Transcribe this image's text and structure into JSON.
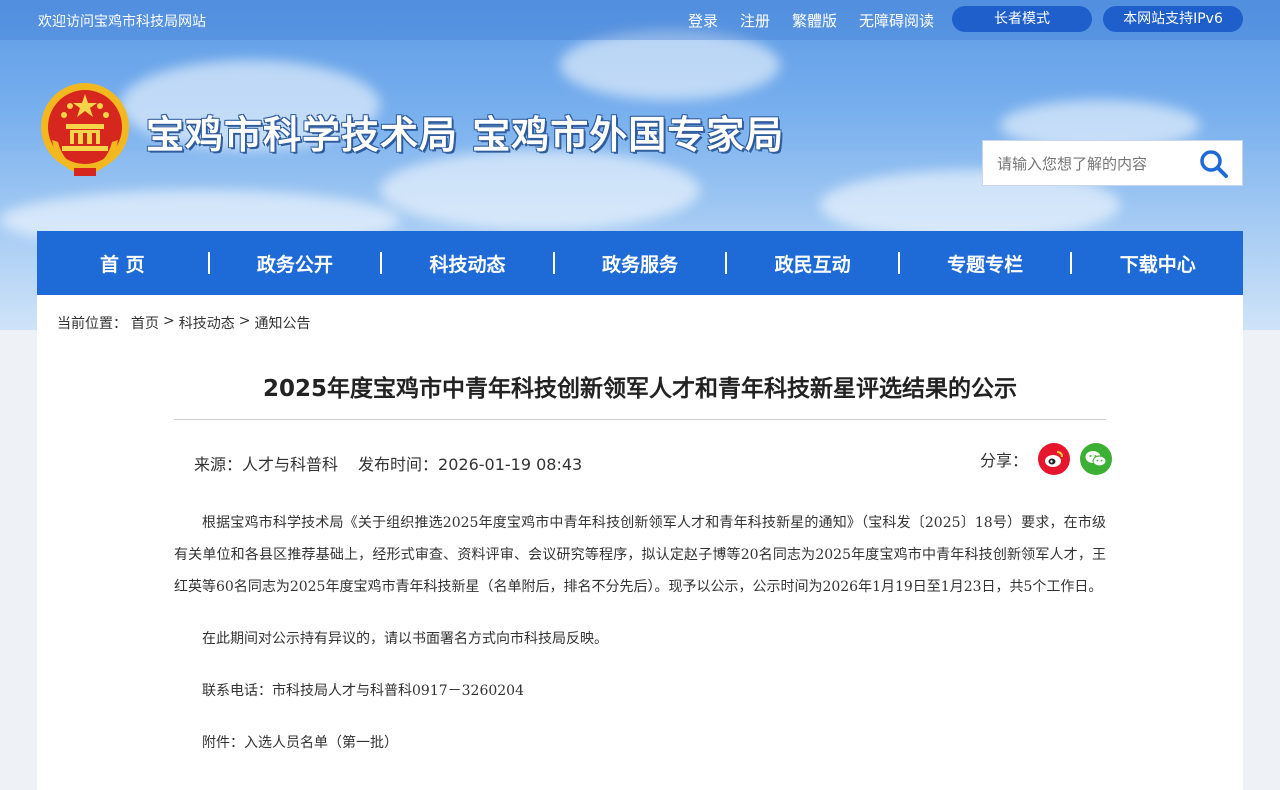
{
  "topbar": {
    "welcome": "欢迎访问宝鸡市科技局网站",
    "links": [
      "登录",
      "注册",
      "繁體版",
      "无障碍阅读"
    ],
    "elder_mode": "长者模式",
    "ipv6": "本网站支持IPv6"
  },
  "header": {
    "site_title": "宝鸡市科学技术局 宝鸡市外国专家局",
    "search_placeholder": "请输入您想了解的内容"
  },
  "nav": [
    "首 页",
    "政务公开",
    "科技动态",
    "政务服务",
    "政民互动",
    "专题专栏",
    "下载中心"
  ],
  "breadcrumb": {
    "prefix": "当前位置：",
    "items": [
      "首页",
      "科技动态",
      "通知公告"
    ],
    "separator": ">"
  },
  "article": {
    "title": "2025年度宝鸡市中青年科技创新领军人才和青年科技新星评选结果的公示",
    "source_label": "来源：",
    "source": "人才与科普科",
    "date_label": "发布时间：",
    "date": "2026-01-19 08:43",
    "share_label": "分享：",
    "paragraphs": [
      "根据宝鸡市科学技术局《关于组织推选2025年度宝鸡市中青年科技创新领军人才和青年科技新星的通知》（宝科发〔2025〕18号）要求，在市级有关单位和各县区推荐基础上，经形式审查、资料评审、会议研究等程序，拟认定赵子博等20名同志为2025年度宝鸡市中青年科技创新领军人才，王红英等60名同志为2025年度宝鸡市青年科技新星（名单附后，排名不分先后）。现予以公示，公示时间为2026年1月19日至1月23日，共5个工作日。",
      "在此期间对公示持有异议的，请以书面署名方式向市科技局反映。",
      "联系电话：市科技局人才与科普科0917－3260204",
      "附件：入选人员名单（第一批）"
    ]
  },
  "colors": {
    "nav": "#1e6ad6",
    "pill": "#1e5fcc",
    "weibo": "#e6162d",
    "wechat": "#3cb034"
  },
  "icons": [
    "national-emblem-icon",
    "search-icon",
    "weibo-icon",
    "wechat-icon"
  ]
}
